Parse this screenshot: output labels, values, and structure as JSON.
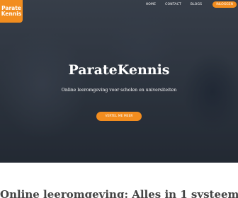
{
  "logo": {
    "line1": "Parate",
    "line2": "Kennis"
  },
  "nav": {
    "items": [
      {
        "label": "HOME"
      },
      {
        "label": "CONTACT"
      },
      {
        "label": "BLOGS"
      }
    ],
    "login_label": "INLOGGEN"
  },
  "hero": {
    "title": "ParateKennis",
    "subtitle": "Online leeromgeving voor scholen en universiteiten",
    "cta_label": "VERTEL ME MEER"
  },
  "section": {
    "heading": "Online leeromgeving: Alles in 1 systeem"
  },
  "colors": {
    "accent": "#f28d1f",
    "text_dark": "#444444"
  }
}
